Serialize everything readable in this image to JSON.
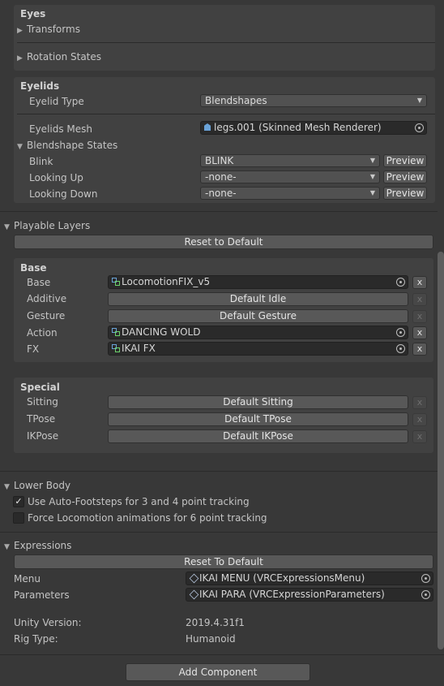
{
  "eyes": {
    "title": "Eyes",
    "transforms_label": "Transforms",
    "rotation_states_label": "Rotation States"
  },
  "eyelids": {
    "title": "Eyelids",
    "type_label": "Eyelid Type",
    "type_value": "Blendshapes",
    "mesh_label": "Eyelids Mesh",
    "mesh_value": "legs.001 (Skinned Mesh Renderer)",
    "blendshape_states_label": "Blendshape States",
    "states": [
      {
        "label": "Blink",
        "value": "BLINK",
        "preview": "Preview"
      },
      {
        "label": "Looking Up",
        "value": "-none-",
        "preview": "Preview"
      },
      {
        "label": "Looking Down",
        "value": "-none-",
        "preview": "Preview"
      }
    ]
  },
  "playable_layers": {
    "title": "Playable Layers",
    "reset_label": "Reset to Default",
    "base": {
      "title": "Base",
      "rows": [
        {
          "label": "Base",
          "value": "LocomotionFIX_v5",
          "kind": "object",
          "x": "x"
        },
        {
          "label": "Additive",
          "value": "Default Idle",
          "kind": "default",
          "x": "x"
        },
        {
          "label": "Gesture",
          "value": "Default Gesture",
          "kind": "default",
          "x": "x"
        },
        {
          "label": "Action",
          "value": "DANCING WOLD",
          "kind": "object",
          "x": "x"
        },
        {
          "label": "FX",
          "value": "IKAI FX",
          "kind": "object",
          "x": "x"
        }
      ]
    },
    "special": {
      "title": "Special",
      "rows": [
        {
          "label": "Sitting",
          "value": "Default Sitting",
          "x": "x"
        },
        {
          "label": "TPose",
          "value": "Default TPose",
          "x": "x"
        },
        {
          "label": "IKPose",
          "value": "Default IKPose",
          "x": "x"
        }
      ]
    }
  },
  "lower_body": {
    "title": "Lower Body",
    "auto_footsteps_label": "Use Auto-Footsteps for 3 and 4 point tracking",
    "auto_footsteps_checked": true,
    "force_locomotion_label": "Force Locomotion animations for 6 point tracking",
    "force_locomotion_checked": false,
    "check_mark": "✓"
  },
  "expressions": {
    "title": "Expressions",
    "reset_label": "Reset To Default",
    "menu_label": "Menu",
    "menu_value": "IKAI MENU (VRCExpressionsMenu)",
    "parameters_label": "Parameters",
    "parameters_value": "IKAI PARA (VRCExpressionParameters)"
  },
  "info": {
    "unity_version_label": "Unity Version:",
    "unity_version_value": "2019.4.31f1",
    "rig_type_label": "Rig Type:",
    "rig_type_value": "Humanoid"
  },
  "add_component_label": "Add Component",
  "icons": {
    "foldout_closed": "▶",
    "foldout_open": "▼",
    "dropdown_arrow": "▼"
  },
  "colors": {
    "background": "#383838",
    "panel": "#414141",
    "field": "#2a2a2a",
    "button": "#585858"
  }
}
